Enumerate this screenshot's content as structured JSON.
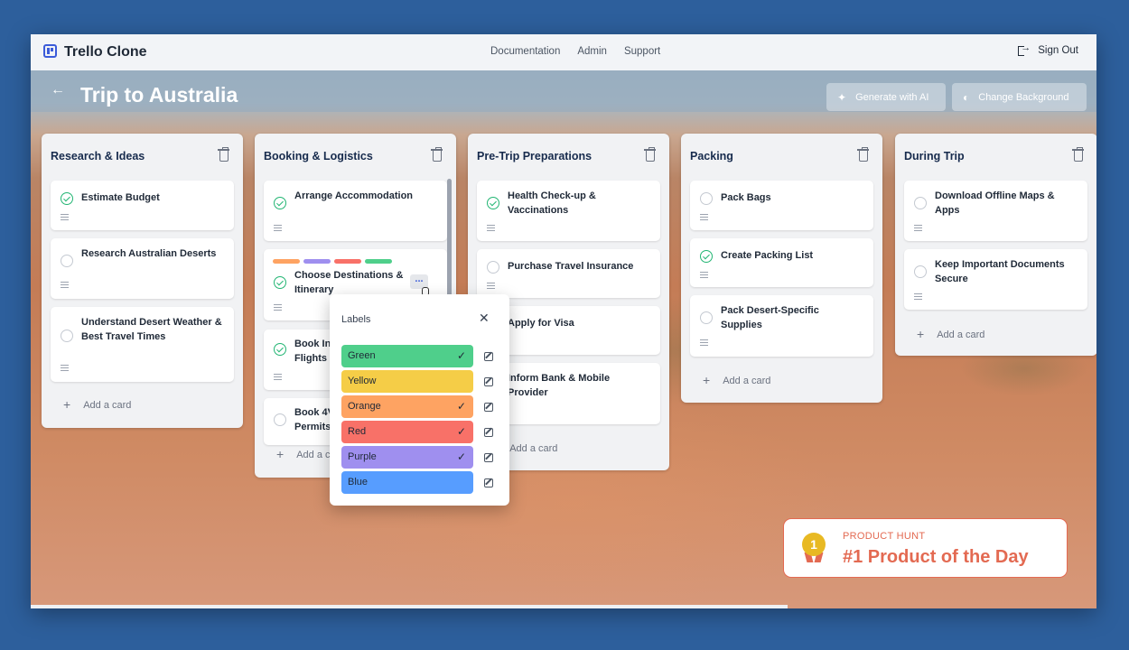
{
  "app": {
    "title": "Trello Clone"
  },
  "nav": {
    "links": [
      "Documentation",
      "Admin",
      "Support"
    ],
    "sign_out": "Sign Out"
  },
  "board": {
    "title": "Trip to Australia",
    "generate_label": "Generate with AI",
    "background_label": "Change Background"
  },
  "add_card_label": "Add a card",
  "lists": [
    {
      "title": "Research & Ideas",
      "cards": [
        {
          "text": "Estimate Budget",
          "done": true
        },
        {
          "text": "Research Australian Deserts",
          "done": false
        },
        {
          "text": "Understand Desert Weather & Best Travel Times",
          "done": false
        }
      ]
    },
    {
      "title": "Booking & Logistics",
      "cards": [
        {
          "text": "Arrange Accommodation",
          "done": true
        },
        {
          "text": "Choose Destinations & Itinerary",
          "done": true
        },
        {
          "text": "Book In… Flights",
          "done": true,
          "visible": [
            "Book In",
            "Flights"
          ]
        },
        {
          "text": "Book 4V… Permits",
          "done": false,
          "visible": [
            "Book 4V",
            "Permits"
          ]
        }
      ],
      "add_card_visible": "Add a c"
    },
    {
      "title": "Pre-Trip Preparations",
      "cards": [
        {
          "text": "Health Check-up & Vaccinations",
          "done": true
        },
        {
          "text": "Purchase Travel Insurance",
          "done": false
        },
        {
          "text": "Apply for Visa",
          "done": false
        },
        {
          "text": "Inform Bank & Mobile Provider",
          "done": false
        }
      ]
    },
    {
      "title": "Packing",
      "cards": [
        {
          "text": "Pack Bags",
          "done": false
        },
        {
          "text": "Create Packing List",
          "done": true
        },
        {
          "text": "Pack Desert-Specific Supplies",
          "done": false
        }
      ]
    },
    {
      "title": "During Trip",
      "cards": [
        {
          "text": "Download Offline Maps & Apps",
          "done": false
        },
        {
          "text": "Keep Important Documents Secure",
          "done": false
        }
      ]
    }
  ],
  "labels_popup": {
    "title": "Labels",
    "labels": [
      {
        "name": "Green",
        "color": "#4fcf8b",
        "checked": true
      },
      {
        "name": "Yellow",
        "color": "#f5cd47",
        "checked": false
      },
      {
        "name": "Orange",
        "color": "#fea362",
        "checked": true
      },
      {
        "name": "Red",
        "color": "#f87168",
        "checked": true
      },
      {
        "name": "Purple",
        "color": "#9f8fef",
        "checked": true
      },
      {
        "name": "Blue",
        "color": "#579dff",
        "checked": false
      }
    ]
  },
  "card_label_colors": [
    "#fea362",
    "#9f8fef",
    "#f87168",
    "#4fcf8b"
  ],
  "badge": {
    "kicker": "PRODUCT HUNT",
    "title": "#1 Product of the Day",
    "rank": "1"
  },
  "colors": {
    "accent": "#3b5bd9",
    "done": "#22b573",
    "badge": "#e36a52"
  }
}
